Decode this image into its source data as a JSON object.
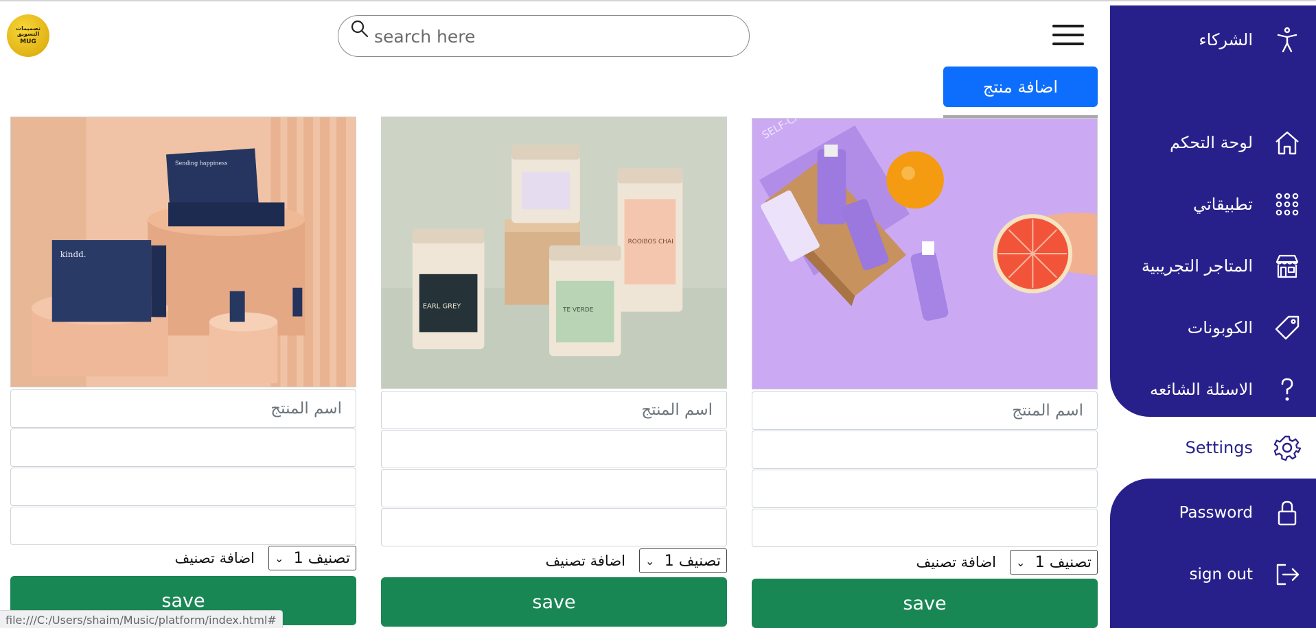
{
  "header": {
    "search_placeholder": "search here",
    "logo_text": "تصميمات التسويق",
    "logo_brand": "MUG",
    "add_product_label": "اضافة منتج"
  },
  "sidebar": {
    "items": [
      {
        "label": "الشركاء",
        "icon": "accessibility-icon",
        "active": false
      },
      {
        "label": "لوحة التحكم",
        "icon": "home-icon",
        "active": false
      },
      {
        "label": "تطبيقاتي",
        "icon": "apps-grid-icon",
        "active": false
      },
      {
        "label": "المتاجر التجريبية",
        "icon": "store-icon",
        "active": false
      },
      {
        "label": "الكوبونات",
        "icon": "tag-icon",
        "active": false
      },
      {
        "label": "الاسئلة الشائعه",
        "icon": "question-icon",
        "active": false
      },
      {
        "label": "Settings",
        "icon": "gear-icon",
        "active": true
      },
      {
        "label": "Password",
        "icon": "lock-icon",
        "active": false
      },
      {
        "label": "sign out",
        "icon": "sign-out-icon",
        "active": false
      }
    ]
  },
  "products": [
    {
      "name_placeholder": "اسم المنتج",
      "category_label": "اضافة تصنيف",
      "category_value": "تصنيف 1",
      "save_label": "save",
      "image": "purple skincare box with orange and grapefruit"
    },
    {
      "name_placeholder": "اسم المنتج",
      "category_label": "اضافة تصنيف",
      "category_value": "تصنيف 1",
      "save_label": "save",
      "image": "tea tins on wooden cube"
    },
    {
      "name_placeholder": "اسم المنتج",
      "category_label": "اضافة تصنيف",
      "category_value": "تصنيف 1",
      "save_label": "save",
      "image": "navy gift boxes on peach podiums"
    }
  ],
  "status_bar": {
    "url": "file:///C:/Users/shaim/Music/platform/index.html#"
  },
  "colors": {
    "sidebar_bg": "#28208a",
    "primary": "#0d6efd",
    "success": "#198754"
  }
}
